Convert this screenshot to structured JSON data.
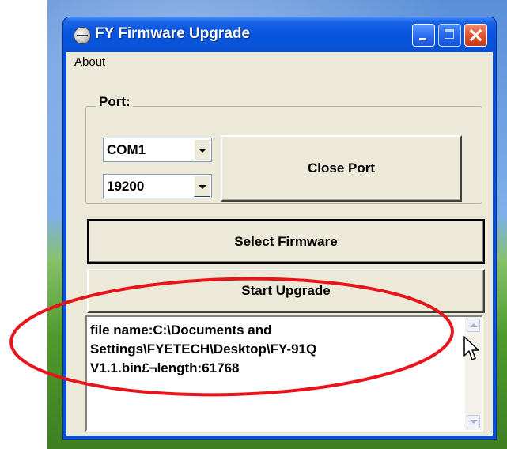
{
  "window": {
    "title": "FY Firmware Upgrade",
    "icon": "app-globe-icon"
  },
  "menubar": {
    "items": [
      {
        "label": "About"
      }
    ]
  },
  "port_group": {
    "label": "Port:",
    "port_select": {
      "value": "COM1"
    },
    "baud_select": {
      "value": "19200"
    },
    "close_port_button": "Close Port"
  },
  "select_firmware_button": "Select Firmware",
  "start_upgrade_button": "Start Upgrade",
  "log": {
    "lines": [
      "file name:C:\\Documents and",
      "Settings\\FYETECH\\Desktop\\FY-91Q",
      "V1.1.bin£¬length:61768"
    ]
  },
  "colors": {
    "titlebar": "#0a56e0",
    "window_face": "#ece9d8",
    "annotation_ellipse": "#e8141c"
  }
}
